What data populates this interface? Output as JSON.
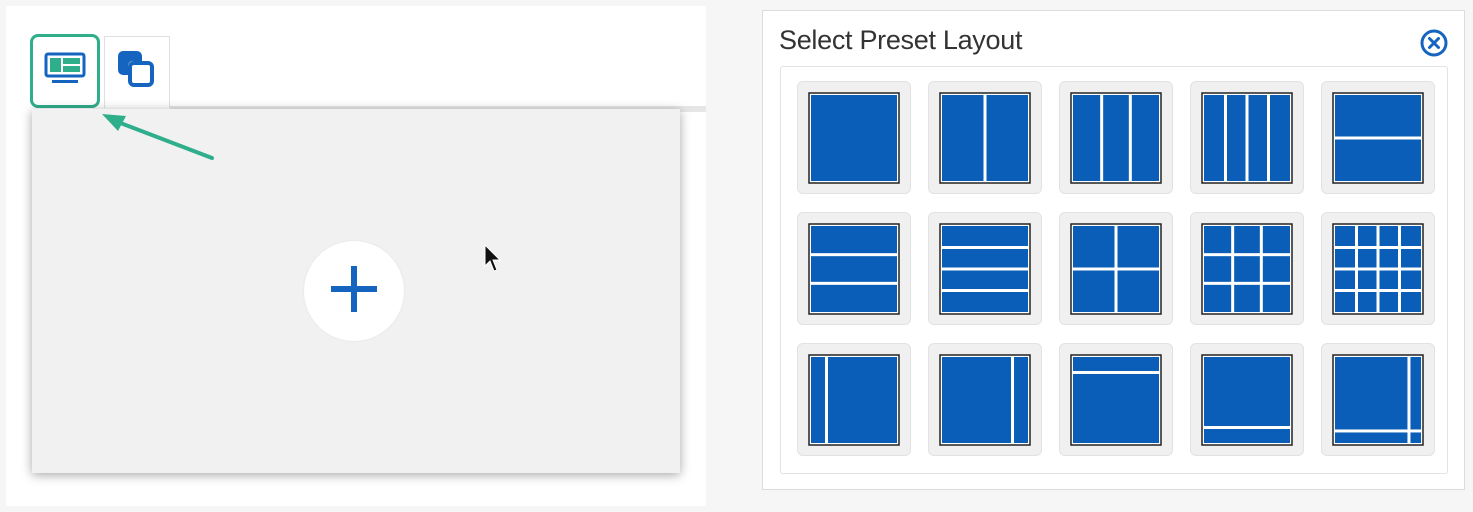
{
  "tabs": [
    {
      "name": "layout",
      "icon": "layout-icon",
      "active": true
    },
    {
      "name": "windows",
      "icon": "overlapping-windows-icon",
      "active": false
    }
  ],
  "canvas": {
    "add_icon": "plus-icon"
  },
  "dialog": {
    "title": "Select Preset Layout",
    "close_icon": "close-circle-icon",
    "presets": [
      {
        "name": "single"
      },
      {
        "name": "two-columns"
      },
      {
        "name": "three-columns"
      },
      {
        "name": "four-columns"
      },
      {
        "name": "two-rows"
      },
      {
        "name": "three-rows"
      },
      {
        "name": "four-rows"
      },
      {
        "name": "grid-2x2"
      },
      {
        "name": "grid-3x3"
      },
      {
        "name": "grid-4x4"
      },
      {
        "name": "narrow-left-column"
      },
      {
        "name": "narrow-right-column"
      },
      {
        "name": "narrow-top-row"
      },
      {
        "name": "narrow-bottom-row"
      },
      {
        "name": "narrow-right-and-bottom"
      }
    ]
  },
  "colors": {
    "accent_green": "#2fae8c",
    "layout_blue": "#0a5eb8",
    "icon_blue": "#1565c0"
  }
}
